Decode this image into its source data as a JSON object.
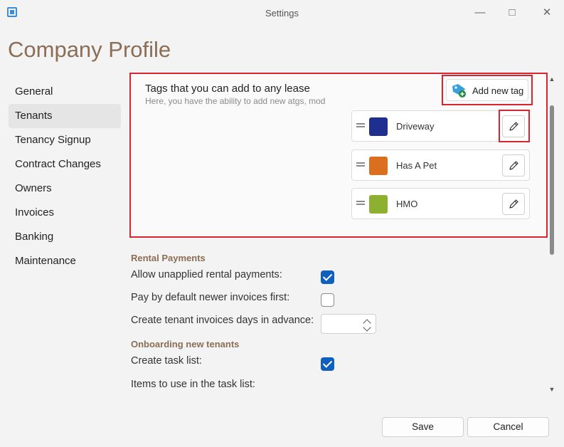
{
  "window": {
    "title": "Settings"
  },
  "page": {
    "title": "Company Profile"
  },
  "sidebar": {
    "items": [
      {
        "label": "General"
      },
      {
        "label": "Tenants",
        "active": true
      },
      {
        "label": "Tenancy Signup"
      },
      {
        "label": "Contract Changes"
      },
      {
        "label": "Owners"
      },
      {
        "label": "Invoices"
      },
      {
        "label": "Banking"
      },
      {
        "label": "Maintenance"
      }
    ]
  },
  "tags": {
    "title": "Tags that you can add to any lease",
    "subtitle": "Here, you have the ability to add new atgs, mod",
    "add_label": "Add new tag",
    "items": [
      {
        "name": "Driveway",
        "color": "#1f2f8f"
      },
      {
        "name": "Has A Pet",
        "color": "#dc6e1f"
      },
      {
        "name": "HMO",
        "color": "#8db030"
      }
    ]
  },
  "rental_payments": {
    "title": "Rental Payments",
    "allow_unapplied": {
      "label": "Allow unapplied rental payments:",
      "checked": true
    },
    "pay_newer_first": {
      "label": "Pay by default newer invoices first:",
      "checked": false
    },
    "days_in_advance": {
      "label": "Create tenant invoices days in advance:",
      "value": ""
    }
  },
  "onboarding": {
    "title": "Onboarding new tenants",
    "create_task_list": {
      "label": "Create task list:",
      "checked": true
    },
    "items_label": "Items to use in the task list:"
  },
  "footer": {
    "save_label": "Save",
    "cancel_label": "Cancel"
  },
  "colors": {
    "accent": "#0f5fbf",
    "highlight": "#d7262f",
    "heading": "#8a6e55"
  }
}
